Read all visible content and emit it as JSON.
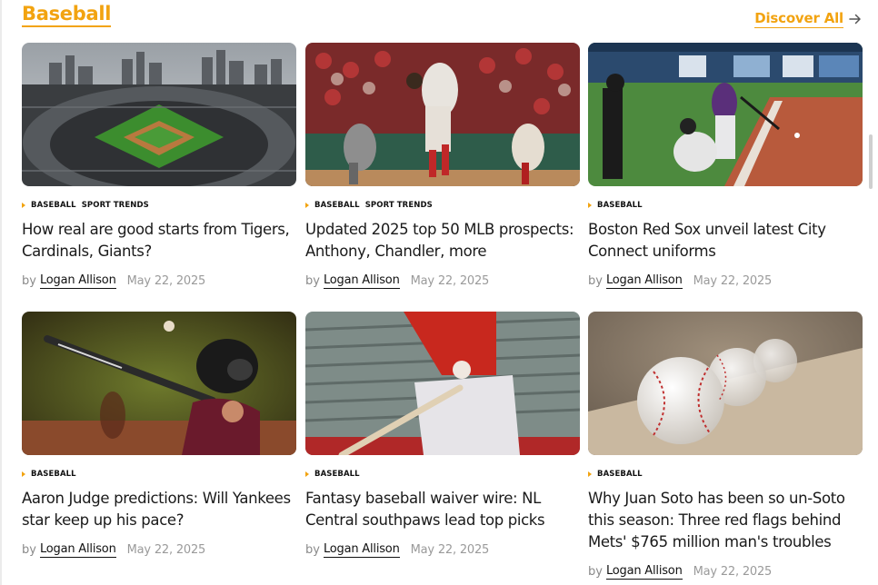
{
  "section": {
    "title": "Baseball",
    "discover_label": "Discover All"
  },
  "colors": {
    "accent": "#f2a310"
  },
  "articles": [
    {
      "tags": [
        "BASEBALL",
        "SPORT TRENDS"
      ],
      "headline": "How real are good starts from Tigers, Cardinals, Giants?",
      "by": "by",
      "author": "Logan Allison",
      "date": "May 22, 2025",
      "image": "stadium-aerial-photo"
    },
    {
      "tags": [
        "BASEBALL",
        "SPORT TRENDS"
      ],
      "headline": "Updated 2025 top 50 MLB prospects: Anthony, Chandler, more",
      "by": "by",
      "author": "Logan Allison",
      "date": "May 22, 2025",
      "image": "pitcher-photo"
    },
    {
      "tags": [
        "BASEBALL"
      ],
      "headline": "Boston Red Sox unveil latest City Connect uniforms",
      "by": "by",
      "author": "Logan Allison",
      "date": "May 22, 2025",
      "image": "batter-swing-photo"
    },
    {
      "tags": [
        "BASEBALL"
      ],
      "headline": "Aaron Judge predictions: Will Yankees star keep up his pace?",
      "by": "by",
      "author": "Logan Allison",
      "date": "May 22, 2025",
      "image": "young-batter-photo"
    },
    {
      "tags": [
        "BASEBALL"
      ],
      "headline": "Fantasy baseball waiver wire: NL Central southpaws lead top picks",
      "by": "by",
      "author": "Logan Allison",
      "date": "May 22, 2025",
      "image": "batter-closeup-photo"
    },
    {
      "tags": [
        "BASEBALL"
      ],
      "headline": "Why Juan Soto has been so un-Soto this season: Three red flags behind Mets' $765 million man's troubles",
      "by": "by",
      "author": "Logan Allison",
      "date": "May 22, 2025",
      "image": "baseballs-closeup-photo"
    }
  ]
}
